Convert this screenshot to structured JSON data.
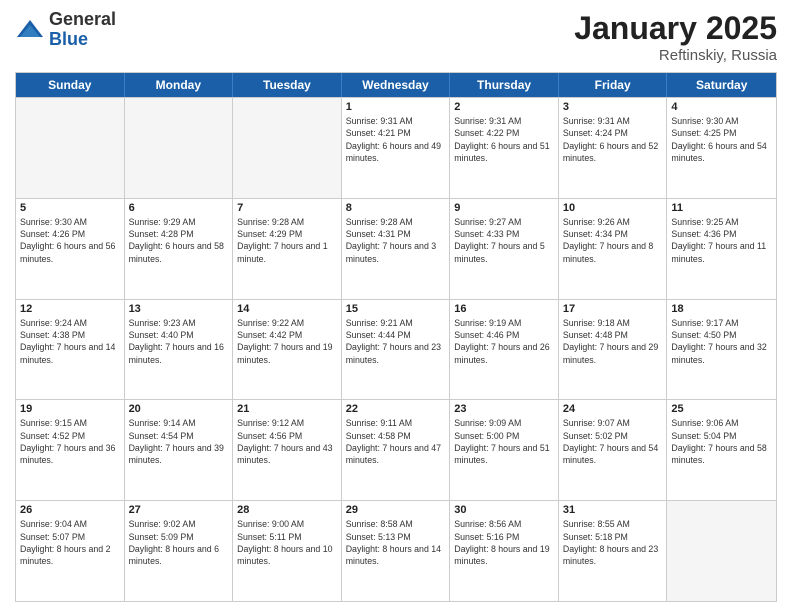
{
  "logo": {
    "general": "General",
    "blue": "Blue"
  },
  "title": "January 2025",
  "subtitle": "Reftinskiy, Russia",
  "header_days": [
    "Sunday",
    "Monday",
    "Tuesday",
    "Wednesday",
    "Thursday",
    "Friday",
    "Saturday"
  ],
  "weeks": [
    [
      {
        "day": "",
        "empty": true
      },
      {
        "day": "",
        "empty": true
      },
      {
        "day": "",
        "empty": true
      },
      {
        "day": "1",
        "sunrise": "Sunrise: 9:31 AM",
        "sunset": "Sunset: 4:21 PM",
        "daylight": "Daylight: 6 hours and 49 minutes."
      },
      {
        "day": "2",
        "sunrise": "Sunrise: 9:31 AM",
        "sunset": "Sunset: 4:22 PM",
        "daylight": "Daylight: 6 hours and 51 minutes."
      },
      {
        "day": "3",
        "sunrise": "Sunrise: 9:31 AM",
        "sunset": "Sunset: 4:24 PM",
        "daylight": "Daylight: 6 hours and 52 minutes."
      },
      {
        "day": "4",
        "sunrise": "Sunrise: 9:30 AM",
        "sunset": "Sunset: 4:25 PM",
        "daylight": "Daylight: 6 hours and 54 minutes."
      }
    ],
    [
      {
        "day": "5",
        "sunrise": "Sunrise: 9:30 AM",
        "sunset": "Sunset: 4:26 PM",
        "daylight": "Daylight: 6 hours and 56 minutes."
      },
      {
        "day": "6",
        "sunrise": "Sunrise: 9:29 AM",
        "sunset": "Sunset: 4:28 PM",
        "daylight": "Daylight: 6 hours and 58 minutes."
      },
      {
        "day": "7",
        "sunrise": "Sunrise: 9:28 AM",
        "sunset": "Sunset: 4:29 PM",
        "daylight": "Daylight: 7 hours and 1 minute."
      },
      {
        "day": "8",
        "sunrise": "Sunrise: 9:28 AM",
        "sunset": "Sunset: 4:31 PM",
        "daylight": "Daylight: 7 hours and 3 minutes."
      },
      {
        "day": "9",
        "sunrise": "Sunrise: 9:27 AM",
        "sunset": "Sunset: 4:33 PM",
        "daylight": "Daylight: 7 hours and 5 minutes."
      },
      {
        "day": "10",
        "sunrise": "Sunrise: 9:26 AM",
        "sunset": "Sunset: 4:34 PM",
        "daylight": "Daylight: 7 hours and 8 minutes."
      },
      {
        "day": "11",
        "sunrise": "Sunrise: 9:25 AM",
        "sunset": "Sunset: 4:36 PM",
        "daylight": "Daylight: 7 hours and 11 minutes."
      }
    ],
    [
      {
        "day": "12",
        "sunrise": "Sunrise: 9:24 AM",
        "sunset": "Sunset: 4:38 PM",
        "daylight": "Daylight: 7 hours and 14 minutes."
      },
      {
        "day": "13",
        "sunrise": "Sunrise: 9:23 AM",
        "sunset": "Sunset: 4:40 PM",
        "daylight": "Daylight: 7 hours and 16 minutes."
      },
      {
        "day": "14",
        "sunrise": "Sunrise: 9:22 AM",
        "sunset": "Sunset: 4:42 PM",
        "daylight": "Daylight: 7 hours and 19 minutes."
      },
      {
        "day": "15",
        "sunrise": "Sunrise: 9:21 AM",
        "sunset": "Sunset: 4:44 PM",
        "daylight": "Daylight: 7 hours and 23 minutes."
      },
      {
        "day": "16",
        "sunrise": "Sunrise: 9:19 AM",
        "sunset": "Sunset: 4:46 PM",
        "daylight": "Daylight: 7 hours and 26 minutes."
      },
      {
        "day": "17",
        "sunrise": "Sunrise: 9:18 AM",
        "sunset": "Sunset: 4:48 PM",
        "daylight": "Daylight: 7 hours and 29 minutes."
      },
      {
        "day": "18",
        "sunrise": "Sunrise: 9:17 AM",
        "sunset": "Sunset: 4:50 PM",
        "daylight": "Daylight: 7 hours and 32 minutes."
      }
    ],
    [
      {
        "day": "19",
        "sunrise": "Sunrise: 9:15 AM",
        "sunset": "Sunset: 4:52 PM",
        "daylight": "Daylight: 7 hours and 36 minutes."
      },
      {
        "day": "20",
        "sunrise": "Sunrise: 9:14 AM",
        "sunset": "Sunset: 4:54 PM",
        "daylight": "Daylight: 7 hours and 39 minutes."
      },
      {
        "day": "21",
        "sunrise": "Sunrise: 9:12 AM",
        "sunset": "Sunset: 4:56 PM",
        "daylight": "Daylight: 7 hours and 43 minutes."
      },
      {
        "day": "22",
        "sunrise": "Sunrise: 9:11 AM",
        "sunset": "Sunset: 4:58 PM",
        "daylight": "Daylight: 7 hours and 47 minutes."
      },
      {
        "day": "23",
        "sunrise": "Sunrise: 9:09 AM",
        "sunset": "Sunset: 5:00 PM",
        "daylight": "Daylight: 7 hours and 51 minutes."
      },
      {
        "day": "24",
        "sunrise": "Sunrise: 9:07 AM",
        "sunset": "Sunset: 5:02 PM",
        "daylight": "Daylight: 7 hours and 54 minutes."
      },
      {
        "day": "25",
        "sunrise": "Sunrise: 9:06 AM",
        "sunset": "Sunset: 5:04 PM",
        "daylight": "Daylight: 7 hours and 58 minutes."
      }
    ],
    [
      {
        "day": "26",
        "sunrise": "Sunrise: 9:04 AM",
        "sunset": "Sunset: 5:07 PM",
        "daylight": "Daylight: 8 hours and 2 minutes."
      },
      {
        "day": "27",
        "sunrise": "Sunrise: 9:02 AM",
        "sunset": "Sunset: 5:09 PM",
        "daylight": "Daylight: 8 hours and 6 minutes."
      },
      {
        "day": "28",
        "sunrise": "Sunrise: 9:00 AM",
        "sunset": "Sunset: 5:11 PM",
        "daylight": "Daylight: 8 hours and 10 minutes."
      },
      {
        "day": "29",
        "sunrise": "Sunrise: 8:58 AM",
        "sunset": "Sunset: 5:13 PM",
        "daylight": "Daylight: 8 hours and 14 minutes."
      },
      {
        "day": "30",
        "sunrise": "Sunrise: 8:56 AM",
        "sunset": "Sunset: 5:16 PM",
        "daylight": "Daylight: 8 hours and 19 minutes."
      },
      {
        "day": "31",
        "sunrise": "Sunrise: 8:55 AM",
        "sunset": "Sunset: 5:18 PM",
        "daylight": "Daylight: 8 hours and 23 minutes."
      },
      {
        "day": "",
        "empty": true
      }
    ]
  ]
}
